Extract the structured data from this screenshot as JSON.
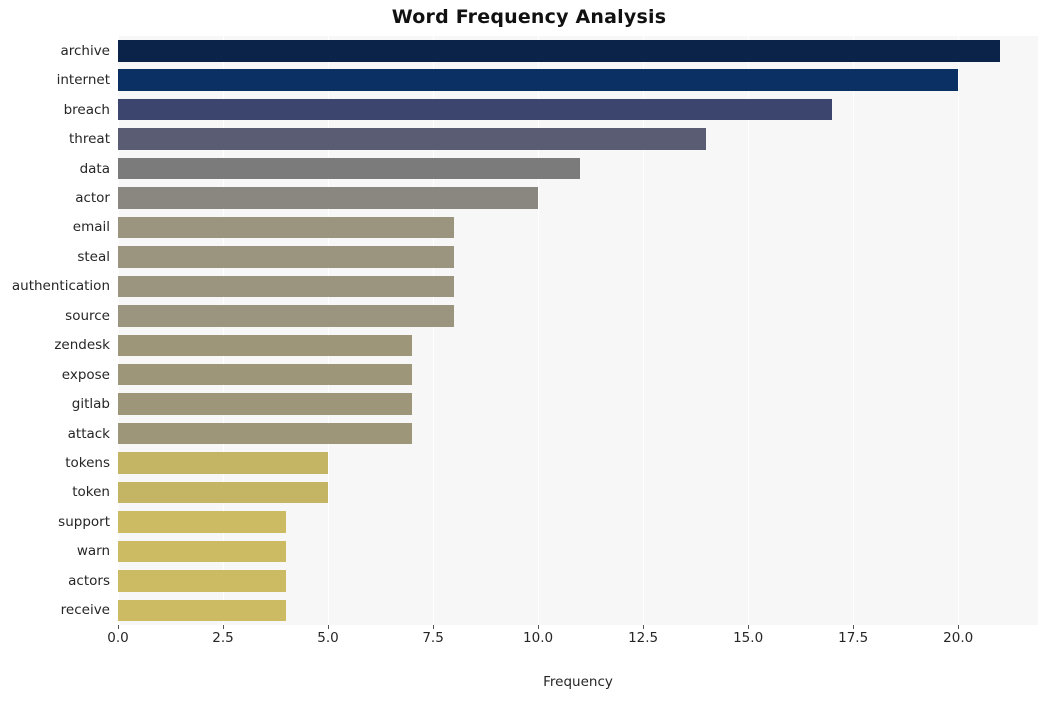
{
  "chart_data": {
    "type": "bar",
    "orientation": "horizontal",
    "title": "Word Frequency Analysis",
    "xlabel": "Frequency",
    "ylabel": "",
    "xlim": [
      0,
      21.9
    ],
    "grid": true,
    "legend": null,
    "xticks": [
      "0.0",
      "2.5",
      "5.0",
      "7.5",
      "10.0",
      "12.5",
      "15.0",
      "17.5",
      "20.0"
    ],
    "xtick_values": [
      0,
      2.5,
      5,
      7.5,
      10,
      12.5,
      15,
      17.5,
      20
    ],
    "categories": [
      "archive",
      "internet",
      "breach",
      "threat",
      "data",
      "actor",
      "email",
      "steal",
      "authentication",
      "source",
      "zendesk",
      "expose",
      "gitlab",
      "attack",
      "tokens",
      "token",
      "support",
      "warn",
      "actors",
      "receive"
    ],
    "values": [
      21,
      20,
      17,
      14,
      11,
      10,
      8,
      8,
      8,
      8,
      7,
      7,
      7,
      7,
      5,
      5,
      4,
      4,
      4,
      4
    ],
    "colors": [
      "#0b2349",
      "#0b3063",
      "#3b456e",
      "#5a5c74",
      "#7b7b7b",
      "#8a8780",
      "#9b9580",
      "#9b9580",
      "#9b9580",
      "#9b9580",
      "#9e9678",
      "#9e9678",
      "#9e9678",
      "#9e9678",
      "#c4b565",
      "#c4b565",
      "#cdbb63",
      "#cdbb63",
      "#cdbb63",
      "#cdbb63"
    ],
    "plot_background": "#f7f7f7",
    "grid_color": "#ffffff"
  }
}
